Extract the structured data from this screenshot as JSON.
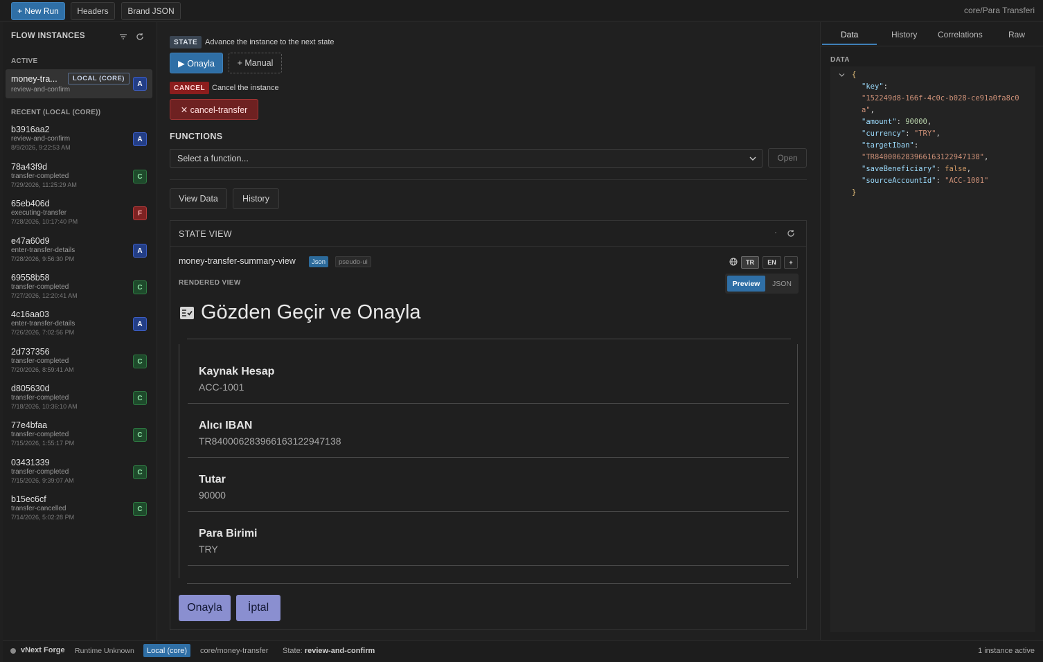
{
  "toolbar": {
    "new_run": "+ New Run",
    "headers": "Headers",
    "brand_json": "Brand JSON",
    "breadcrumb": "core/Para Transferi"
  },
  "sidebar": {
    "title": "FLOW INSTANCES",
    "active_label": "ACTIVE",
    "active_item": {
      "id": "money-tra...",
      "scope": "LOCAL (CORE)",
      "state": "review-and-confirm",
      "badge": "A"
    },
    "recent_label": "RECENT (LOCAL (CORE))",
    "items": [
      {
        "id": "b3916aa2",
        "state": "review-and-confirm",
        "time": "8/9/2026, 9:22:53 AM",
        "badge": "A"
      },
      {
        "id": "78a43f9d",
        "state": "transfer-completed",
        "time": "7/29/2026, 11:25:29 AM",
        "badge": "C"
      },
      {
        "id": "65eb406d",
        "state": "executing-transfer",
        "time": "7/28/2026, 10:17:40 PM",
        "badge": "F"
      },
      {
        "id": "e47a60d9",
        "state": "enter-transfer-details",
        "time": "7/28/2026, 9:56:30 PM",
        "badge": "A"
      },
      {
        "id": "69558b58",
        "state": "transfer-completed",
        "time": "7/27/2026, 12:20:41 AM",
        "badge": "C"
      },
      {
        "id": "4c16aa03",
        "state": "enter-transfer-details",
        "time": "7/26/2026, 7:02:56 PM",
        "badge": "A"
      },
      {
        "id": "2d737356",
        "state": "transfer-completed",
        "time": "7/20/2026, 8:59:41 AM",
        "badge": "C"
      },
      {
        "id": "d805630d",
        "state": "transfer-completed",
        "time": "7/18/2026, 10:36:10 AM",
        "badge": "C"
      },
      {
        "id": "77e4bfaa",
        "state": "transfer-completed",
        "time": "7/15/2026, 1:55:17 PM",
        "badge": "C"
      },
      {
        "id": "03431339",
        "state": "transfer-completed",
        "time": "7/15/2026, 9:39:07 AM",
        "badge": "C"
      },
      {
        "id": "b15ec6cf",
        "state": "transfer-cancelled",
        "time": "7/14/2026, 5:02:28 PM",
        "badge": "C"
      }
    ]
  },
  "main": {
    "state_tag": "STATE",
    "state_desc": "Advance the instance to the next state",
    "onayla_btn": "▶ Onayla",
    "manual_btn": "+ Manual",
    "cancel_tag": "CANCEL",
    "cancel_desc": "Cancel the instance",
    "cancel_btn": "✕ cancel-transfer",
    "functions_title": "FUNCTIONS",
    "function_placeholder": "Select a function...",
    "open_btn": "Open",
    "view_data_btn": "View Data",
    "history_btn": "History"
  },
  "state_view": {
    "title": "STATE VIEW",
    "dot": "·",
    "view_name": "money-transfer-summary-view",
    "json_pill": "Json",
    "pseudo_pill": "pseudo-ui",
    "lang_tr": "TR",
    "lang_en": "EN",
    "lang_add": "+",
    "rendered_label": "RENDERED VIEW",
    "preview_tab": "Preview",
    "json_tab": "JSON",
    "heading": "Gözden Geçir ve Onayla",
    "fields": [
      {
        "label": "Kaynak Hesap",
        "value": "ACC-1001"
      },
      {
        "label": "Alıcı IBAN",
        "value": "TR840006283966163122947138"
      },
      {
        "label": "Tutar",
        "value": "90000"
      },
      {
        "label": "Para Birimi",
        "value": "TRY"
      }
    ],
    "approve_btn": "Onayla",
    "cancel_btn": "İptal"
  },
  "right_panel": {
    "tabs": [
      "Data",
      "History",
      "Correlations",
      "Raw"
    ],
    "data_label": "DATA",
    "json": {
      "key": "\"152249d8-166f-4c0c-b028-ce91a0fa8c0",
      "key_cont": "a\"",
      "amount": "90000",
      "currency": "\"TRY\"",
      "targetIban": "\"TR840006283966163122947138\"",
      "saveBeneficiary": "false",
      "sourceAccountId": "\"ACC-1001\""
    }
  },
  "status_bar": {
    "app_name": "vNext Forge",
    "runtime": "Runtime Unknown",
    "scope": "Local (core)",
    "flow": "core/money-transfer",
    "state_label": "State:",
    "state_value": "review-and-confirm",
    "instances": "1 instance active"
  },
  "colors": {
    "accent_blue": "#2f6fa6",
    "cancel_red": "#8c1d1d",
    "action_lavender": "#8a8fd0",
    "badge_active": "#233e86",
    "badge_completed": "#1e4a2b",
    "badge_failed": "#7d2222"
  }
}
